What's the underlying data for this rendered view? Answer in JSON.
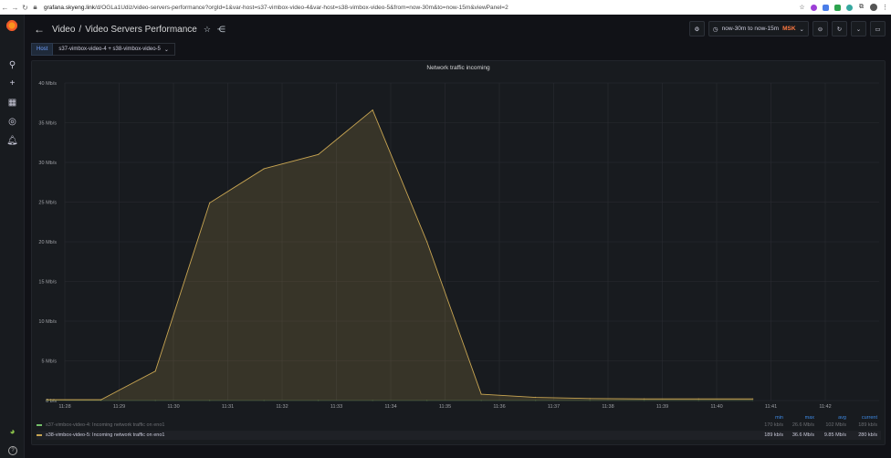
{
  "browser": {
    "url_host": "grafana.skyeng.link",
    "url_path": "/d/OGLa1Udiz/video-servers-performance?orgId=1&var-host=s37-vimbox-video-4&var-host=s38-vimbox-video-5&from=now-30m&to=now-15m&viewPanel=2"
  },
  "header": {
    "folder": "Video",
    "title": "Video Servers Performance",
    "time_range": "now-30m to now-15m",
    "time_shift": "MSK"
  },
  "variables": {
    "label": "Host",
    "value": "s37-vimbox-video-4 + s38-vimbox-video-5"
  },
  "panel": {
    "title": "Network traffic incoming"
  },
  "chart_data": {
    "type": "area",
    "title": "Network traffic incoming",
    "x": [
      "11:27:40",
      "11:28:40",
      "11:29:40",
      "11:30:40",
      "11:31:40",
      "11:32:40",
      "11:33:40",
      "11:34:40",
      "11:35:40",
      "11:36:40",
      "11:37:40",
      "11:38:40",
      "11:39:40",
      "11:40:40"
    ],
    "x_ticks": [
      "11:28",
      "11:29",
      "11:30",
      "11:31",
      "11:32",
      "11:33",
      "11:34",
      "11:35",
      "11:36",
      "11:37",
      "11:38",
      "11:39",
      "11:40",
      "11:41",
      "11:42"
    ],
    "y_ticks": [
      "0 b/s",
      "5 Mb/s",
      "10 Mb/s",
      "15 Mb/s",
      "20 Mb/s",
      "25 Mb/s",
      "30 Mb/s",
      "35 Mb/s",
      "40 Mb/s"
    ],
    "ylim": [
      0,
      40
    ],
    "yunit": "Mb/s",
    "series": [
      {
        "name": "s37-vimbox-video-4: Incoming network traffic on eno1",
        "color": "#73bf69",
        "values": [
          0.0,
          0.0,
          0.0,
          0.0,
          0.0,
          0.0,
          0.0,
          0.0,
          0.0,
          0.0,
          0.0,
          0.0,
          0.0,
          0.0
        ],
        "min": "170 kb/s",
        "max": "26.6 Mb/s",
        "avg": "102 Mb/s",
        "current": "189 kb/s",
        "hidden": true
      },
      {
        "name": "s38-vimbox-video-5: Incoming network traffic on eno1",
        "color": "#c8a552",
        "values": [
          0.1,
          0.1,
          3.7,
          24.9,
          29.2,
          31.0,
          36.6,
          20.0,
          0.8,
          0.4,
          0.25,
          0.2,
          0.2,
          0.2
        ],
        "min": "189 kb/s",
        "max": "36.6 Mb/s",
        "avg": "9.85 Mb/s",
        "current": "280 kb/s"
      }
    ],
    "legend_headers": [
      "min",
      "max",
      "avg",
      "current"
    ],
    "legend_position": "bottom",
    "grid": true
  }
}
